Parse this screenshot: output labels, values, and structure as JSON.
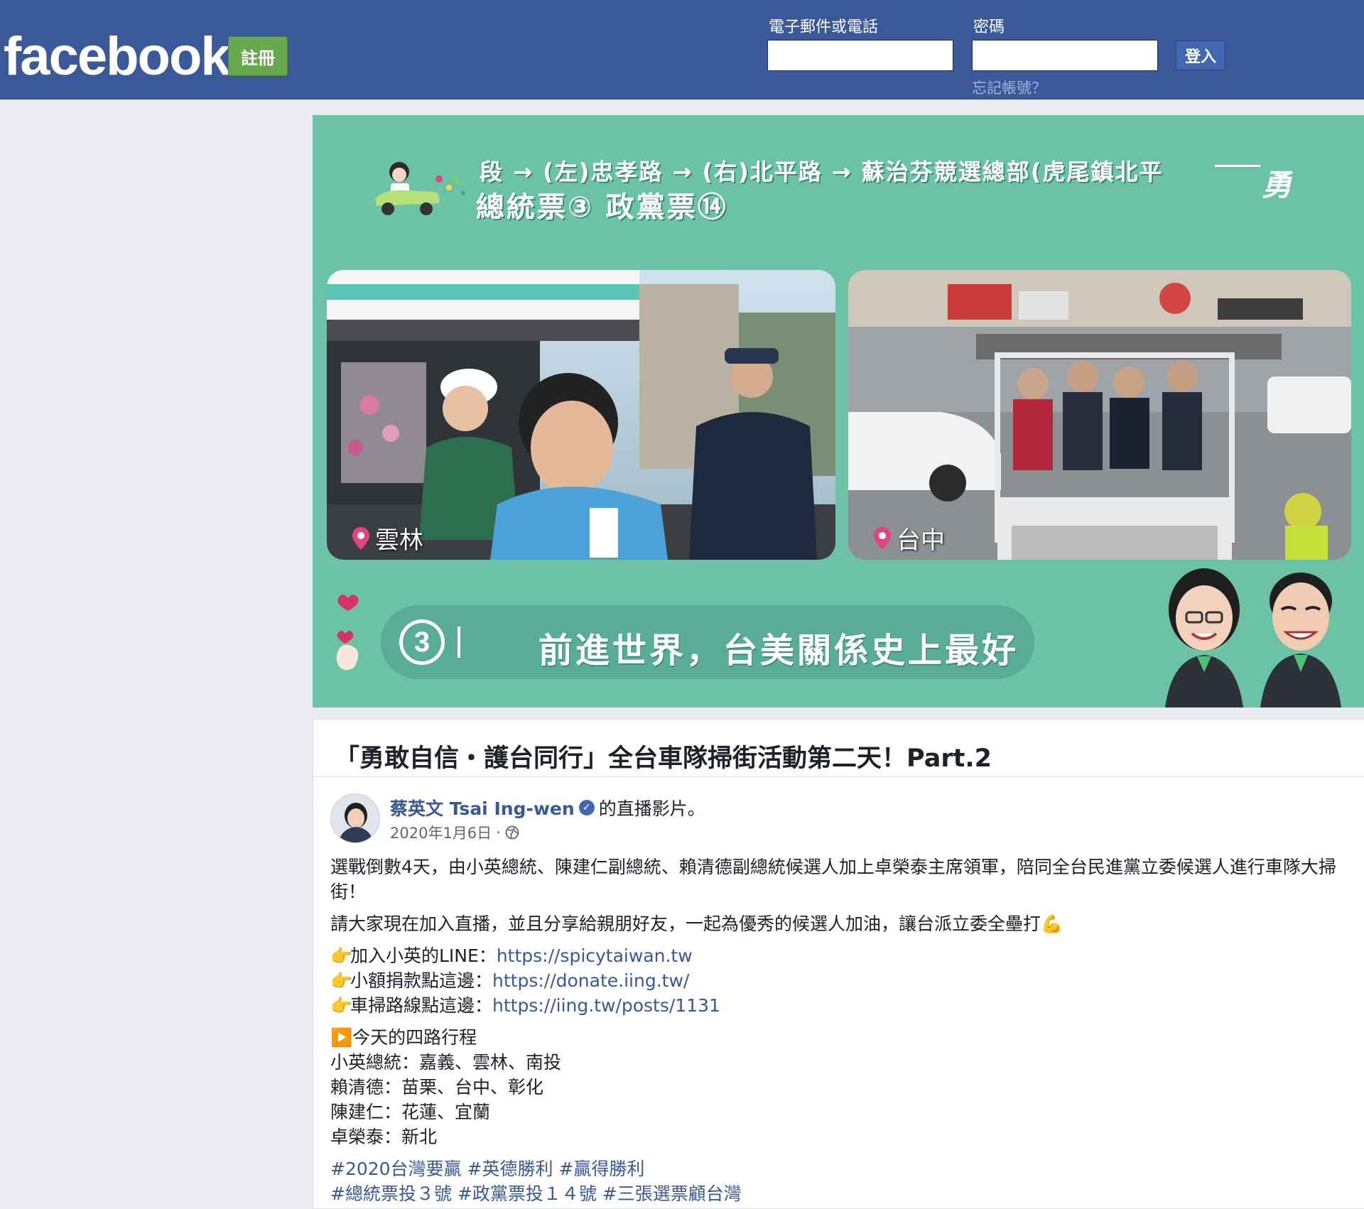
{
  "header": {
    "logo": "facebook",
    "signup_label": "註冊",
    "email_label": "電子郵件或電話",
    "email_value": "",
    "password_label": "密碼",
    "password_value": "",
    "login_label": "登入",
    "forgot_label": "忘記帳號？"
  },
  "video": {
    "route_text": "段 → (左)忠孝路 → (右)北平路 → 蘇治芬競選總部(虎尾鎮北平",
    "ballot_text": "總統票③ 政黨票⑭",
    "corner_text": "勇",
    "left_feed_location": "雲林",
    "right_feed_location": "台中",
    "banner_number": "3",
    "banner_text": "前進世界，台美關係史上最好",
    "colors": {
      "background": "#6cc2a7",
      "banner": "#58ad94"
    }
  },
  "post": {
    "title": "「勇敢自信・護台同行」全台車隊掃街活動第二天！Part.2",
    "author": "蔡英文 Tsai Ing-wen",
    "author_suffix": "的直播影片。",
    "date": "2020年1月6日",
    "date_separator": "·",
    "paragraph1": "選戰倒數4天，由小英總統、陳建仁副總統、賴清德副總統候選人加上卓榮泰主席領軍，陪同全台民進黨立委候選人進行車隊大掃街！",
    "paragraph2": "請大家現在加入直播，並且分享給親朋好友，一起為優秀的候選人加油，讓台派立委全壘打💪",
    "links": [
      {
        "icon": "👉",
        "label": "加入小英的LINE：",
        "url": "https://spicytaiwan.tw"
      },
      {
        "icon": "👉",
        "label": "小額捐款點這邊：",
        "url": "https://donate.iing.tw/"
      },
      {
        "icon": "👉",
        "label": "車掃路線點這邊：",
        "url": "https://iing.tw/posts/1131"
      }
    ],
    "schedule_heading_icon": "▶️",
    "schedule_heading": "今天的四路行程",
    "schedule": [
      "小英總統：嘉義、雲林、南投",
      "賴清德：苗栗、台中、彰化",
      "陳建仁：花蓮、宜蘭",
      "卓榮泰：新北"
    ],
    "hashtags_line1": "#2020台灣要贏 #英德勝利 #贏得勝利",
    "hashtags_line2": "#總統票投３號 #政黨票投１４號 #三張選票顧台灣"
  }
}
